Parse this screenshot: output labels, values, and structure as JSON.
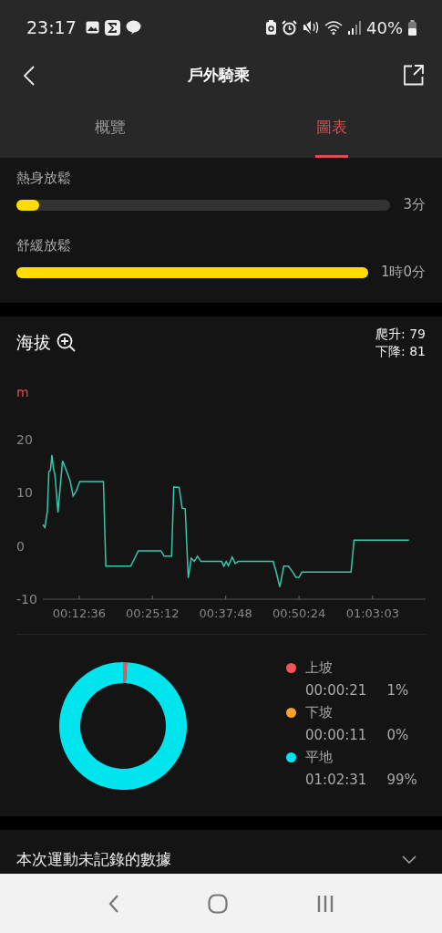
{
  "status_bar": {
    "time": "23:17",
    "battery": "40%"
  },
  "header": {
    "title": "戶外騎乘"
  },
  "tabs": [
    {
      "label": "概覽",
      "selected": false
    },
    {
      "label": "圖表",
      "selected": true
    }
  ],
  "zones": [
    {
      "name": "熱身放鬆",
      "level": 0.06,
      "reading": "3分"
    },
    {
      "name": "舒緩放鬆",
      "level": 1,
      "reading": "1時0分"
    }
  ],
  "altitude": {
    "title": "海拔",
    "climb": "爬升: 79",
    "descent": "下降: 81",
    "chart_data": {
      "type": "line",
      "ylabel": "m",
      "x": [
        381,
        403,
        428,
        443,
        459,
        475,
        490,
        506,
        537,
        584,
        615,
        662,
        693,
        725,
        762,
        1006,
        1031,
        1288,
        1366,
        1600,
        1632,
        1710,
        1732,
        1788,
        1819,
        1850,
        1882,
        1913,
        1944,
        1976,
        2013,
        2226,
        2248,
        2273,
        2295,
        2335,
        2366,
        2398,
        2757,
        2789,
        2826,
        2867,
        2914,
        2960,
        2992,
        3023,
        3054,
        3561,
        3592,
        4158
      ],
      "series": [
        {
          "color": "#35c8aa",
          "values": [
            4.0,
            3.5,
            6.6,
            14,
            14.2,
            17.1,
            14.6,
            13.4,
            6.3,
            16,
            14.6,
            12.3,
            9.4,
            10.3,
            12.1,
            12.1,
            -3.8,
            -3.8,
            -0.9,
            -0.9,
            -1.9,
            -1.9,
            11.1,
            11,
            7.1,
            7,
            -6,
            -2.3,
            -2.9,
            -1.9,
            -2.9,
            -2.9,
            -3.8,
            -2.9,
            -3.7,
            -2.1,
            -3.3,
            -2.9,
            -2.9,
            -4.9,
            -7.7,
            -3.8,
            -3.8,
            -4.9,
            -5.9,
            -5.9,
            -4.9,
            -4.9,
            1.1,
            1.1
          ]
        }
      ],
      "xlim": [
        381,
        4330
      ],
      "ylim": [
        -10,
        20
      ],
      "xticks": [
        {
          "value": 756,
          "label": "00:12:36"
        },
        {
          "value": 1512,
          "label": "00:25:12"
        },
        {
          "value": 2268,
          "label": "00:37:48"
        },
        {
          "value": 3024,
          "label": "00:50:24"
        },
        {
          "value": 3783,
          "label": "01:03:03"
        }
      ],
      "yticks": [
        -10,
        0,
        10,
        20
      ]
    }
  },
  "slope": {
    "chart_data": {
      "type": "donut",
      "categories": [
        "上坡",
        "下坡",
        "平地"
      ],
      "values": [
        1,
        0,
        99
      ]
    },
    "legend": [
      {
        "time": "00:00:21",
        "percent": "1%",
        "color": "#f05454"
      },
      {
        "time": "00:00:11",
        "percent": "0%",
        "color": "#f5a031"
      },
      {
        "time": "01:02:31",
        "percent": "99%",
        "color": "#00e4ee"
      }
    ]
  },
  "unrecorded": {
    "title": "本次運動未記錄的數據"
  }
}
